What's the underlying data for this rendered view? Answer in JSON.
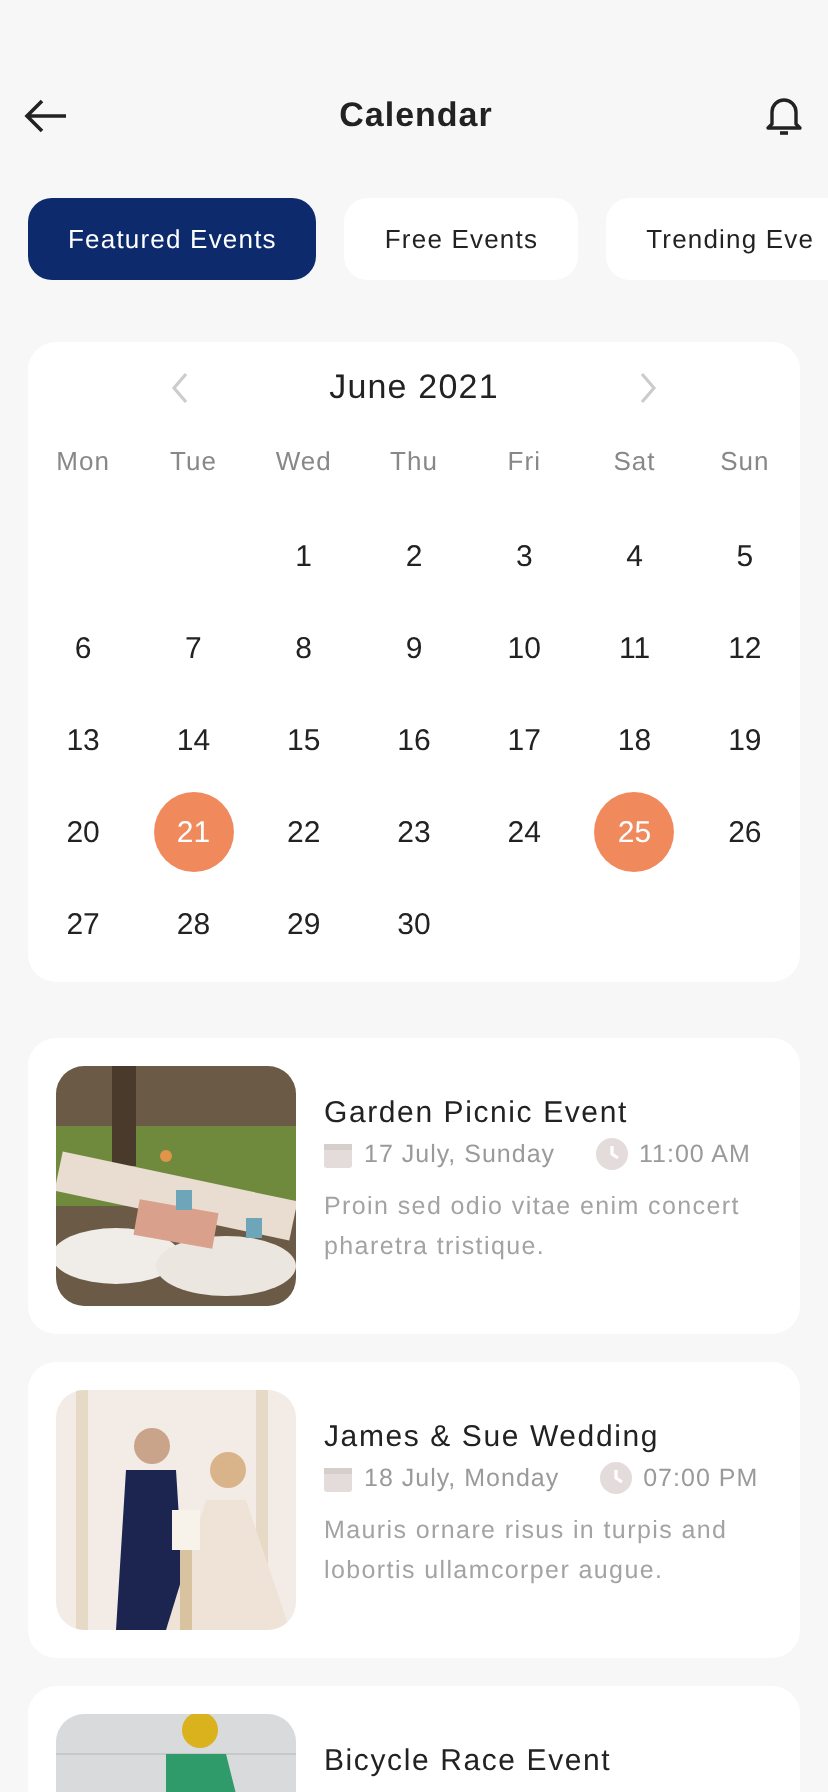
{
  "header": {
    "title": "Calendar"
  },
  "tabs": [
    {
      "label": "Featured Events",
      "selected": true
    },
    {
      "label": "Free Events",
      "selected": false
    },
    {
      "label": "Trending Eve",
      "selected": false
    }
  ],
  "calendar": {
    "month": "June 2021",
    "weekdays": [
      "Mon",
      "Tue",
      "Wed",
      "Thu",
      "Fri",
      "Sat",
      "Sun"
    ],
    "weeks": [
      {
        "days": [
          {
            "day": "1",
            "selected": false
          },
          {
            "day": "2",
            "selected": false
          },
          {
            "day": "3",
            "selected": false
          },
          {
            "day": "4",
            "selected": false
          },
          {
            "day": "5",
            "selected": false
          }
        ]
      },
      {
        "days": [
          {
            "day": "6",
            "selected": false
          },
          {
            "day": "7",
            "selected": false
          },
          {
            "day": "8",
            "selected": false
          },
          {
            "day": "9",
            "selected": false
          },
          {
            "day": "10",
            "selected": false
          },
          {
            "day": "11",
            "selected": false
          },
          {
            "day": "12",
            "selected": false
          }
        ]
      },
      {
        "days": [
          {
            "day": "13",
            "selected": false
          },
          {
            "day": "14",
            "selected": false
          },
          {
            "day": "15",
            "selected": false
          },
          {
            "day": "16",
            "selected": false
          },
          {
            "day": "17",
            "selected": false
          },
          {
            "day": "18",
            "selected": false
          },
          {
            "day": "19",
            "selected": false
          }
        ]
      },
      {
        "days": [
          {
            "day": "20",
            "selected": false
          },
          {
            "day": "21",
            "selected": true
          },
          {
            "day": "22",
            "selected": false
          },
          {
            "day": "23",
            "selected": false
          },
          {
            "day": "24",
            "selected": false
          },
          {
            "day": "25",
            "selected": true
          },
          {
            "day": "26",
            "selected": false
          }
        ]
      },
      {
        "days": [
          {
            "day": "27",
            "selected": false
          },
          {
            "day": "28",
            "selected": false
          },
          {
            "day": "29",
            "selected": false
          },
          {
            "day": "30",
            "selected": false
          }
        ]
      }
    ]
  },
  "events": [
    {
      "title": "Garden Picnic Event",
      "date": "17 July, Sunday",
      "time": "11:00 AM",
      "description": "Proin sed odio vitae enim concert pharetra tristique."
    },
    {
      "title": "James & Sue Wedding",
      "date": "18 July, Monday",
      "time": "07:00 PM",
      "description": "Mauris ornare risus in turpis and lobortis ullamcorper augue."
    },
    {
      "title": "Bicycle Race Event"
    }
  ]
}
